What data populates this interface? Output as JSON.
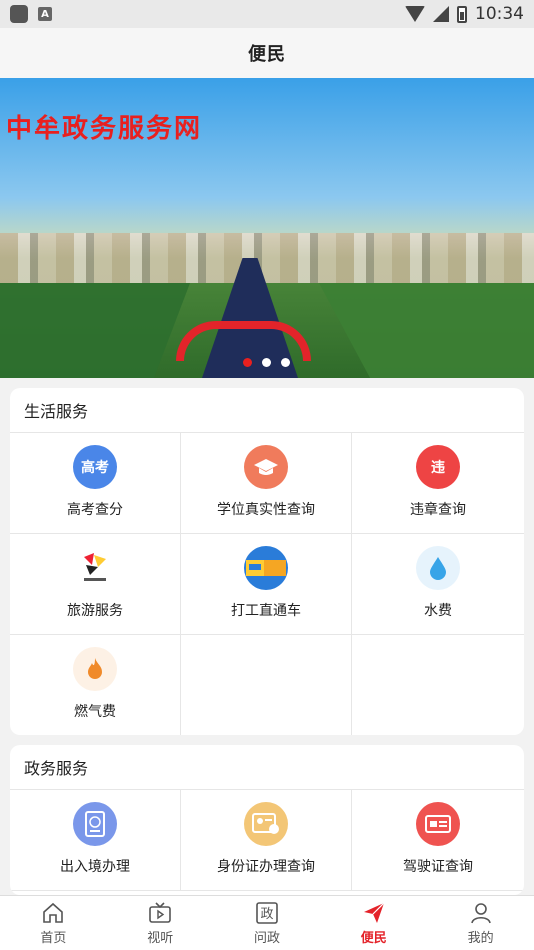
{
  "status_bar": {
    "time": "10:34",
    "badge": "A"
  },
  "header": {
    "title": "便民"
  },
  "banner": {
    "title": "中牟政务服务网",
    "slides": 3,
    "active_slide": 1
  },
  "life_services": {
    "title": "生活服务",
    "items": [
      {
        "label": "高考查分",
        "icon": "gaokao-icon",
        "icon_text": "高考",
        "color": "#4a86e8"
      },
      {
        "label": "学位真实性查询",
        "icon": "graduation-cap-icon",
        "color": "#f07b5c"
      },
      {
        "label": "违章查询",
        "icon": "traffic-violation-icon",
        "icon_text": "违",
        "color": "#ee4444"
      },
      {
        "label": "旅游服务",
        "icon": "travel-logo-icon",
        "color": "#ffcc33"
      },
      {
        "label": "打工直通车",
        "icon": "job-bus-icon",
        "color": "#2a7cd9"
      },
      {
        "label": "水费",
        "icon": "water-drop-icon",
        "color": "#37a4e8"
      },
      {
        "label": "燃气费",
        "icon": "flame-icon",
        "color": "#f08a2a"
      }
    ]
  },
  "gov_services": {
    "title": "政务服务",
    "items": [
      {
        "label": "出入境办理",
        "icon": "passport-icon",
        "color": "#7a97ea"
      },
      {
        "label": "身份证办理查询",
        "icon": "id-card-icon",
        "color": "#f3c676"
      },
      {
        "label": "驾驶证查询",
        "icon": "driver-license-icon",
        "color": "#ef5350"
      }
    ]
  },
  "bottom_nav": {
    "items": [
      {
        "label": "首页",
        "icon": "home-icon"
      },
      {
        "label": "视听",
        "icon": "tv-icon"
      },
      {
        "label": "问政",
        "icon": "gov-icon",
        "icon_text": "政"
      },
      {
        "label": "便民",
        "icon": "paper-plane-icon",
        "active": true
      },
      {
        "label": "我的",
        "icon": "user-icon"
      }
    ]
  }
}
